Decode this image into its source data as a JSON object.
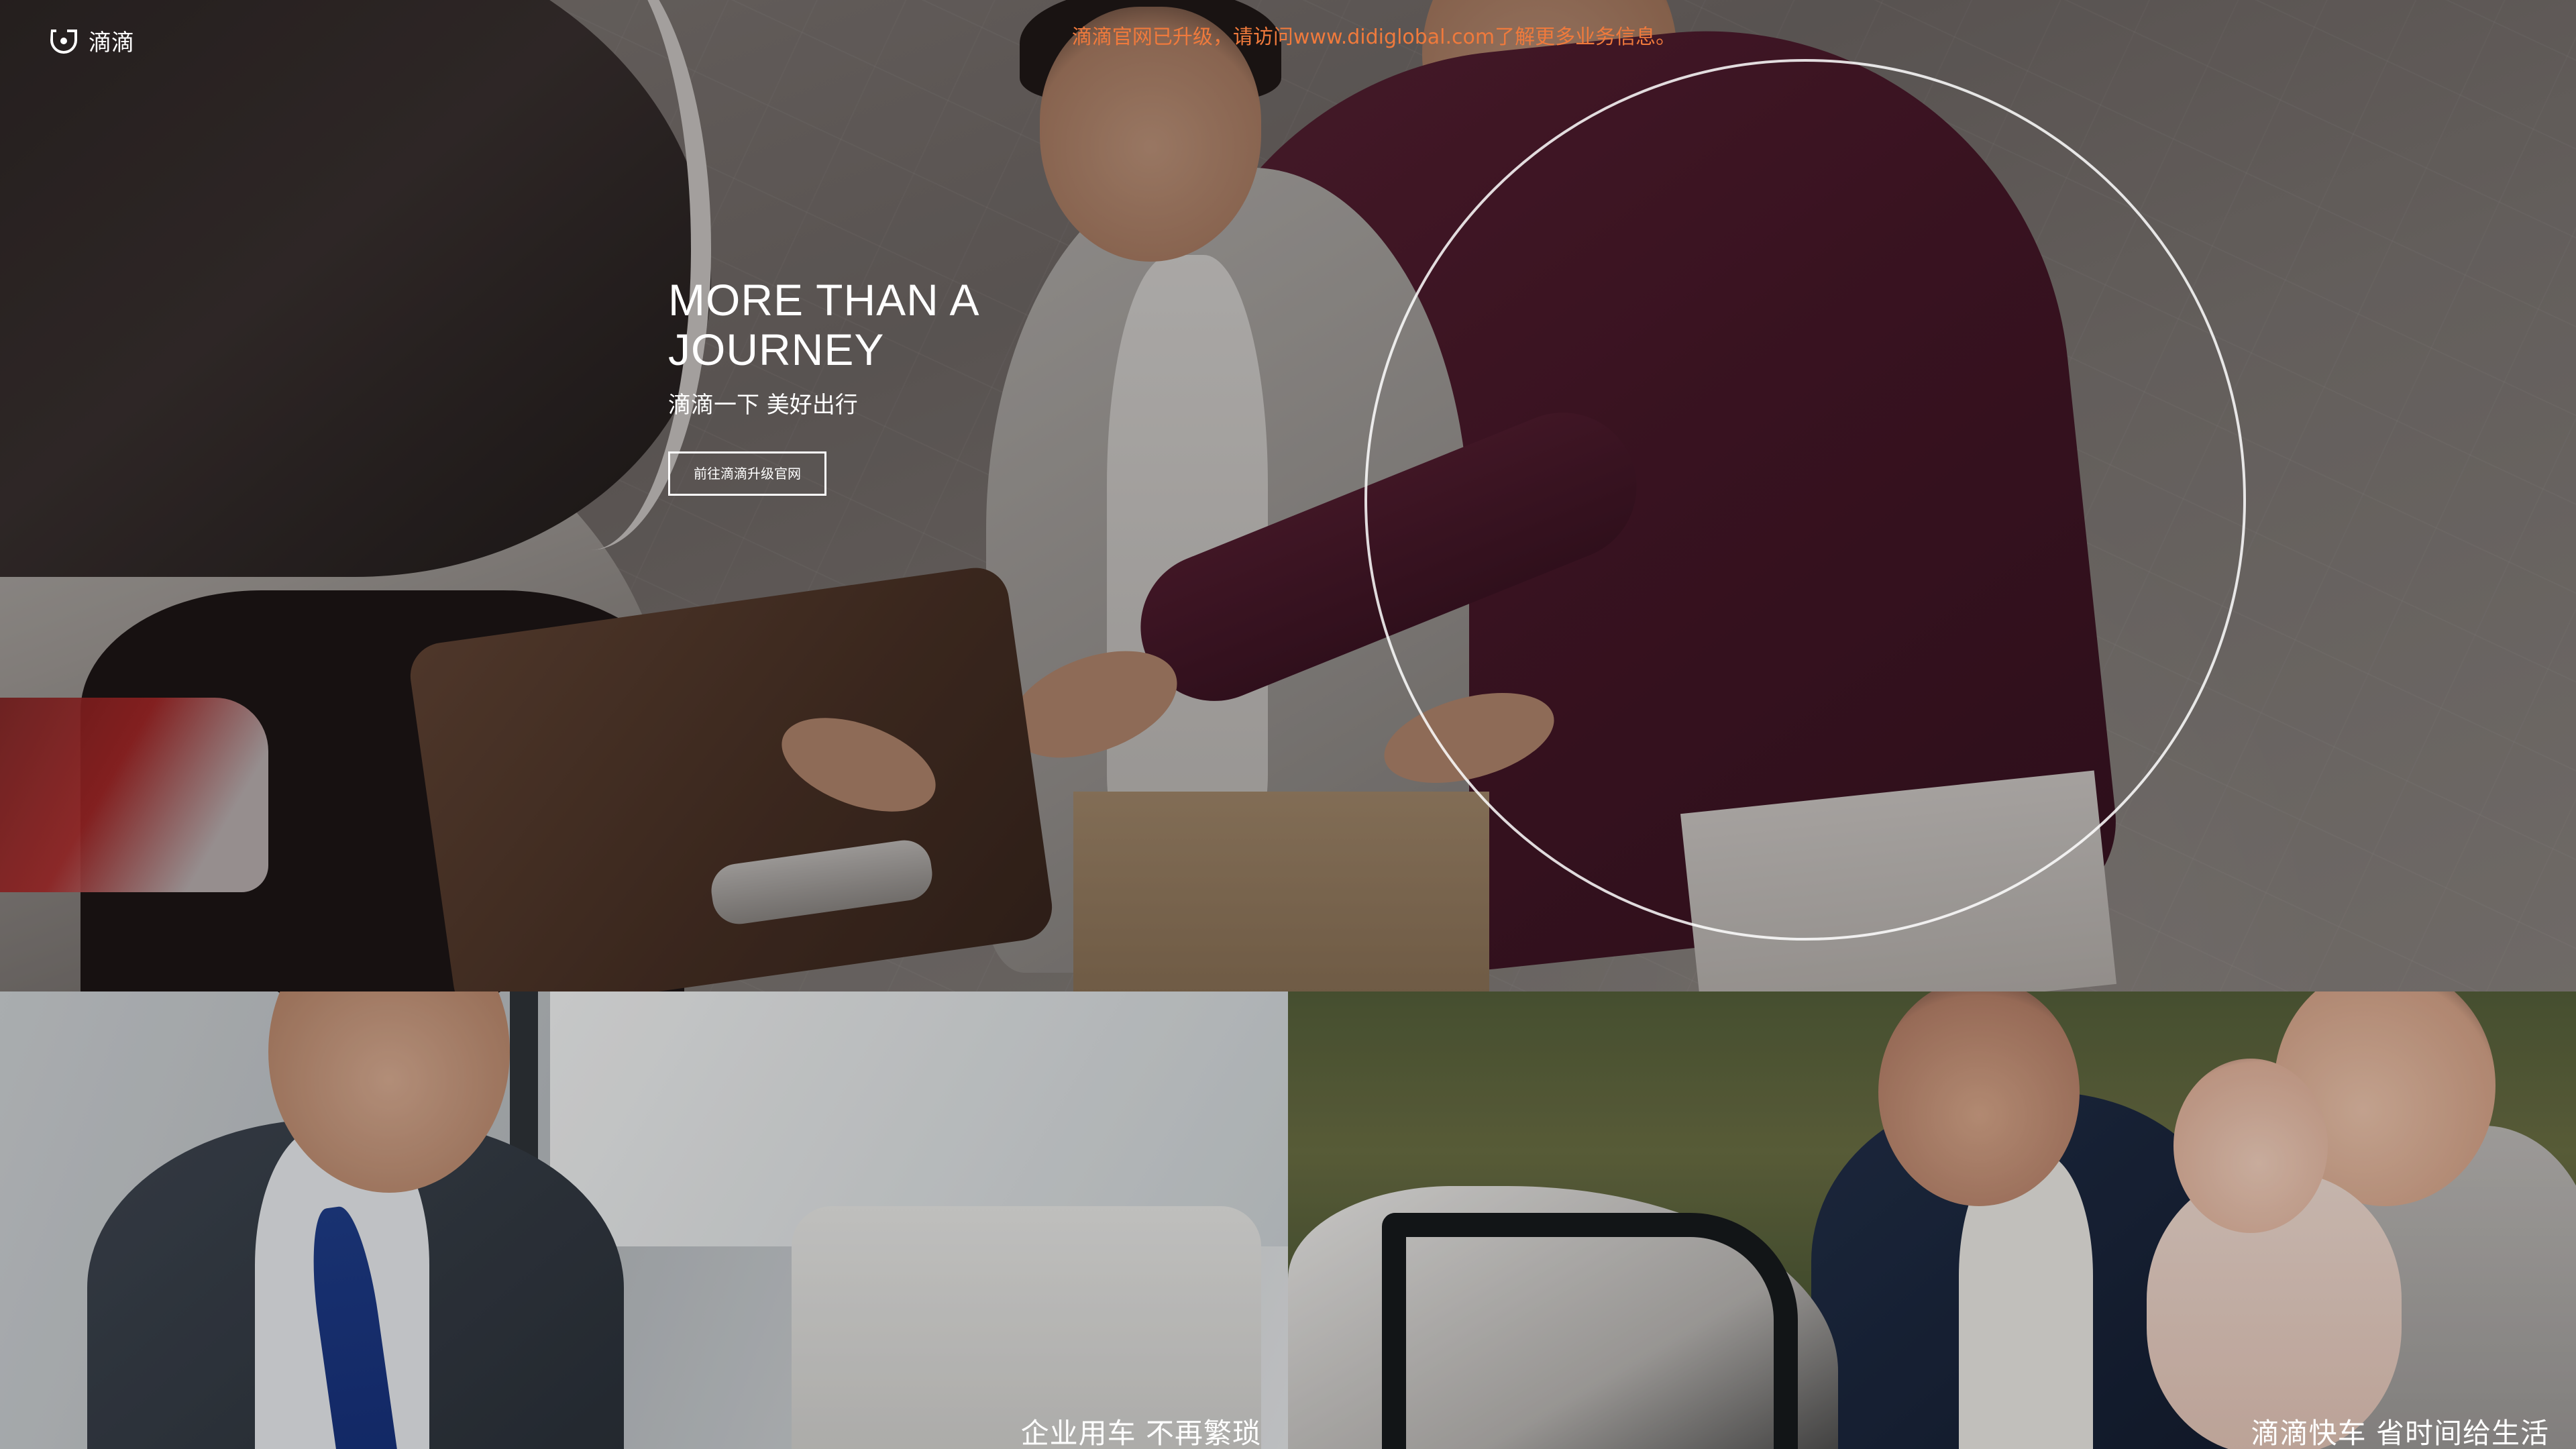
{
  "header": {
    "logo_text": "滴滴",
    "logo_icon": "didi-logo-icon",
    "notice": "滴滴官网已升级，请访问www.didiglobal.com了解更多业务信息。"
  },
  "hero": {
    "title": "MORE THAN A\nJOURNEY",
    "subtitle": "滴滴一下 美好出行",
    "cta_label": "前往滴滴升级官网"
  },
  "panels": [
    {
      "caption": "企业用车 不再繁琐"
    },
    {
      "caption": "滴滴快车 省时间给生活"
    }
  ],
  "colors": {
    "notice": "#f07a3c",
    "text": "#ffffff",
    "circle": "#ffffff"
  }
}
